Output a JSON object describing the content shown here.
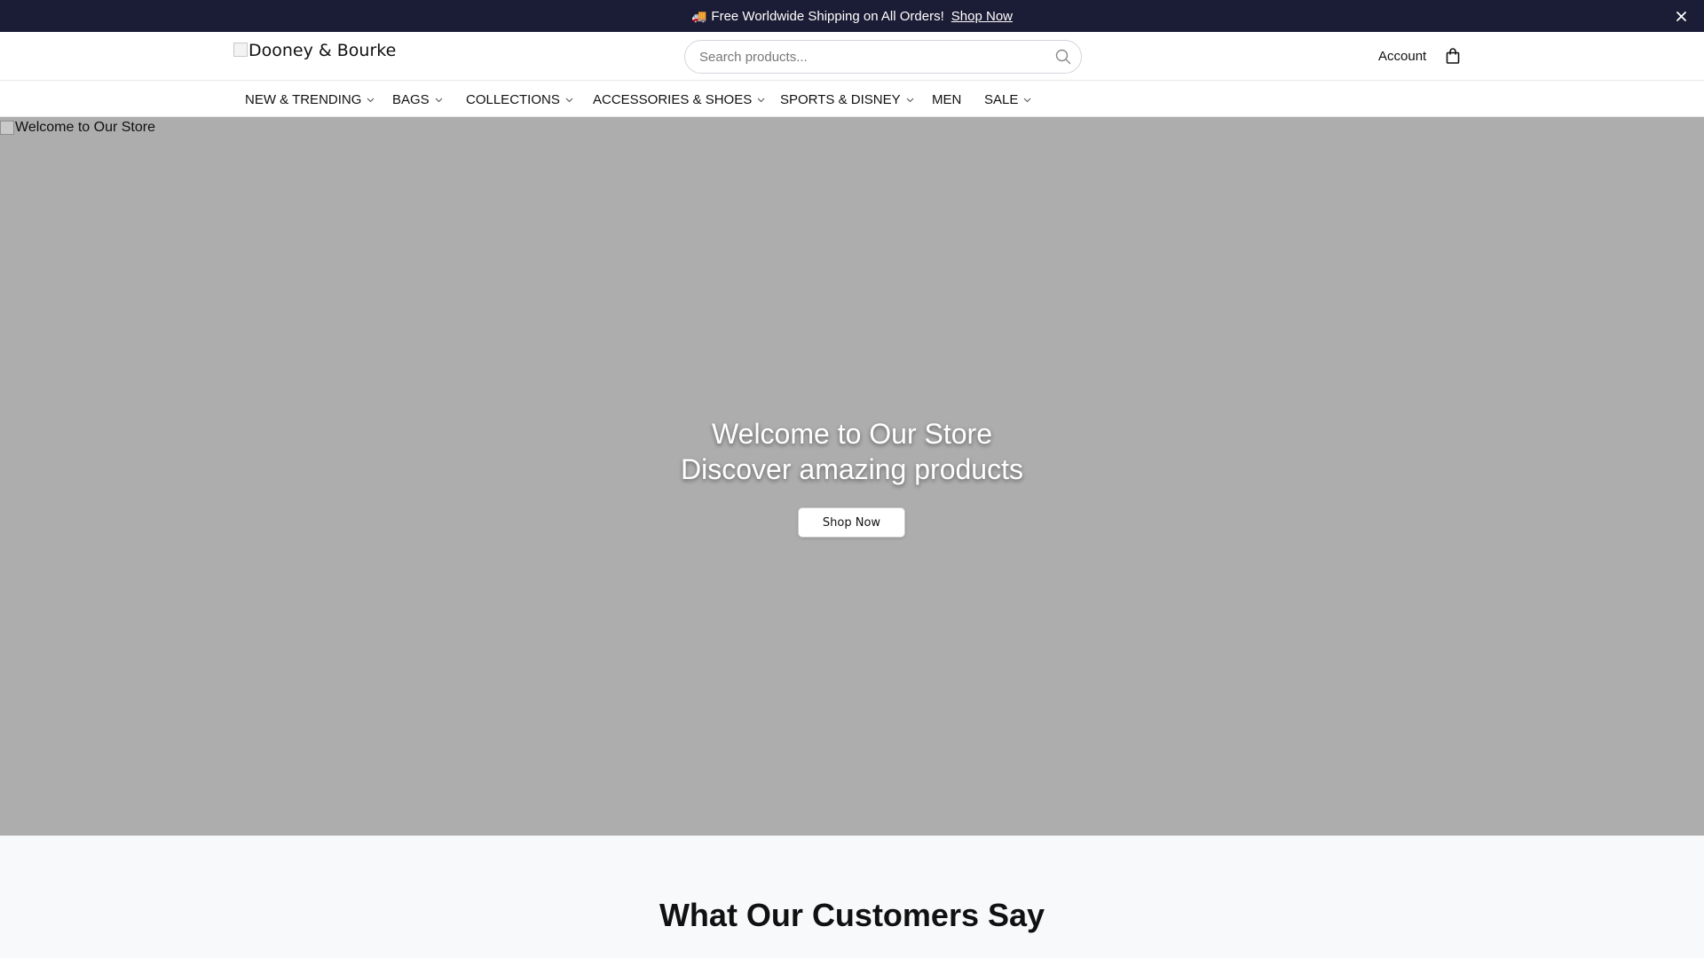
{
  "announcement": {
    "icon": "truck-icon",
    "text": "Free Worldwide Shipping on All Orders!",
    "link_label": "Shop Now",
    "close_label": "×"
  },
  "header": {
    "logo_alt": "Dooney & Bourke",
    "search": {
      "placeholder": "Search products...",
      "value": ""
    },
    "account_label": "Account",
    "cart_icon": "shopping-bag-icon"
  },
  "nav": {
    "items": [
      {
        "label": "NEW & TRENDING",
        "has_dropdown": true
      },
      {
        "label": "BAGS",
        "has_dropdown": true
      },
      {
        "label": "COLLECTIONS",
        "has_dropdown": true
      },
      {
        "label": "ACCESSORIES & SHOES",
        "has_dropdown": true
      },
      {
        "label": "SPORTS & DISNEY",
        "has_dropdown": true
      },
      {
        "label": "MEN",
        "has_dropdown": false
      },
      {
        "label": "SALE",
        "has_dropdown": true
      }
    ]
  },
  "hero": {
    "image_alt": "Welcome to Our Store",
    "title_line1": "Welcome to Our Store",
    "title_line2": "Discover amazing products",
    "cta_label": "Shop Now"
  },
  "testimonials": {
    "heading": "What Our Customers Say"
  },
  "colors": {
    "announcement_bg": "#1b1c35",
    "hero_bg": "#adadad",
    "section_bg": "#f8f9fb"
  }
}
